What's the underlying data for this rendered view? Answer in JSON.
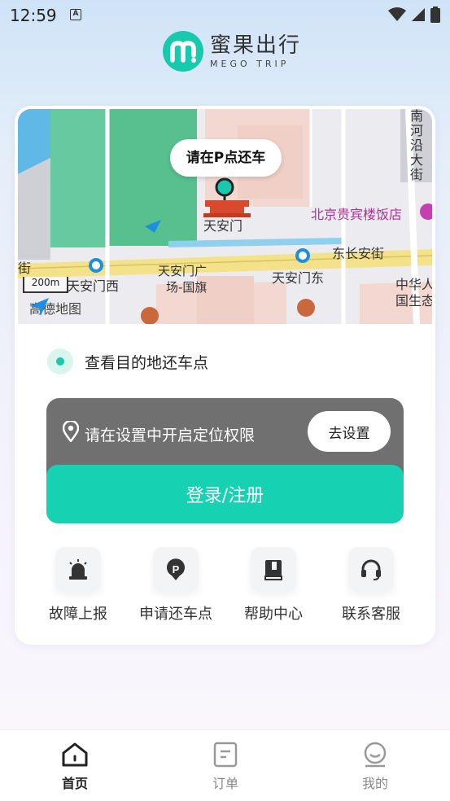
{
  "status_bar": {
    "time": "12:59",
    "notification_icon": "A"
  },
  "logo": {
    "name_cn": "蜜果出行",
    "name_en": "MEGO TRIP",
    "brand_color": "#17c9ad"
  },
  "map": {
    "pin_bubble": "请在P点还车",
    "landmark": "天安门",
    "labels": {
      "hotel": "北京贵宾楼饭店",
      "street": "东长安街",
      "west_station": "天安门西",
      "east_station": "天安门东",
      "square": "天安门广",
      "square2": "场-国旗",
      "jie": "街",
      "right1": "中华人",
      "right2": "国生态",
      "vertical": "南河沿大街"
    },
    "scale": "200m",
    "provider": "高德地图"
  },
  "destination": {
    "label": "查看目的地还车点"
  },
  "location": {
    "message": "请在设置中开启定位权限",
    "settings_button": "去设置"
  },
  "login": {
    "label": "登录/注册"
  },
  "quick_actions": [
    {
      "label": "故障上报",
      "icon": "alarm-icon"
    },
    {
      "label": "申请还车点",
      "icon": "parking-icon"
    },
    {
      "label": "帮助中心",
      "icon": "book-icon"
    },
    {
      "label": "联系客服",
      "icon": "headset-icon"
    }
  ],
  "bottom_nav": [
    {
      "label": "首页",
      "icon": "home-icon",
      "active": true
    },
    {
      "label": "订单",
      "icon": "order-icon",
      "active": false
    },
    {
      "label": "我的",
      "icon": "profile-icon",
      "active": false
    }
  ],
  "colors": {
    "accent": "#17c9ad",
    "button": "#17d1b3",
    "location_box": "#707070"
  }
}
